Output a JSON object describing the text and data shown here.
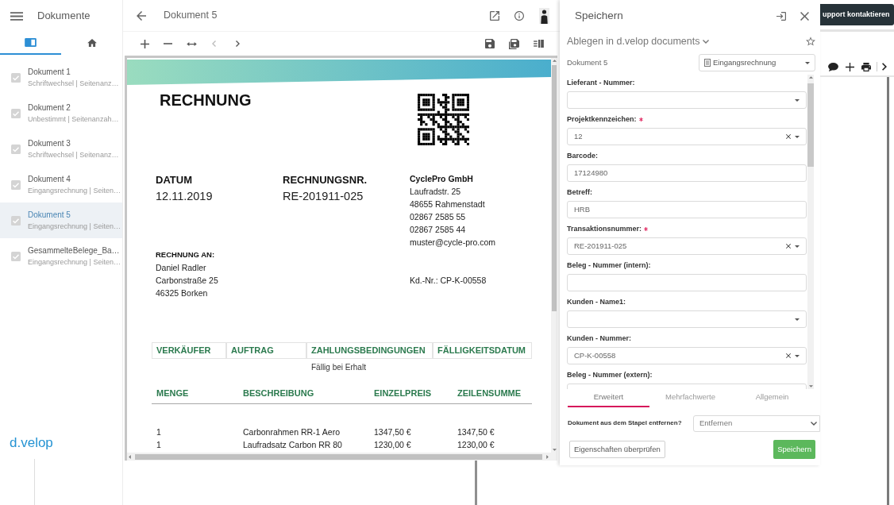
{
  "sidebar": {
    "title": "Dokumente",
    "tabs": [
      {
        "kind": "documents",
        "selected": true
      },
      {
        "kind": "home",
        "selected": false
      }
    ],
    "items": [
      {
        "title": "Dokument 1",
        "subtitle": "Schriftwechsel | Seitenanz…",
        "checked": true,
        "selected": false
      },
      {
        "title": "Dokument 2",
        "subtitle": "Unbestimmt | Seitenanzah…",
        "checked": true,
        "selected": false
      },
      {
        "title": "Dokument 3",
        "subtitle": "Schriftwechsel | Seitenanz…",
        "checked": true,
        "selected": false
      },
      {
        "title": "Dokument 4",
        "subtitle": "Eingangsrechnung | Seiten…",
        "checked": true,
        "selected": false
      },
      {
        "title": "Dokument 5",
        "subtitle": "Eingangsrechnung | Seiten…",
        "checked": true,
        "selected": true
      },
      {
        "title": "GesammelteBelege_Ba…",
        "subtitle": "Eingangsrechnung | Seiten…",
        "checked": true,
        "selected": false
      }
    ],
    "logo": "d.velop"
  },
  "document_header": {
    "title": "Dokument 5"
  },
  "viewer_toolbar": {
    "previous_disabled": true,
    "next_disabled": false
  },
  "document": {
    "heading": "RECHNUNG",
    "date_label": "DATUM",
    "date": "12.11.2019",
    "number_label": "RECHNUNGSNR.",
    "number": "RE-201911-025",
    "company_name": "CyclePro GmbH",
    "company_lines": [
      "Laufradstr. 25",
      "48655 Rahmenstadt",
      "02867 2585 55",
      "02867 2585 44",
      "muster@cycle-pro.com"
    ],
    "bill_to_label": "RECHNUNG AN:",
    "bill_to": [
      "Daniel Radler",
      "Carbonstraße 25",
      "46325 Borken"
    ],
    "customer_number": "Kd.-Nr.: CP-K-00558",
    "terms_table": {
      "columns": [
        "VERKÄUFER",
        "AUFTRAG",
        "ZAHLUNGSBEDINGUNGEN",
        "FÄLLIGKEITSDATUM"
      ],
      "rows": [
        [
          null,
          null,
          "Fällig bei Erhalt",
          null
        ]
      ]
    },
    "items_table": {
      "columns": [
        "MENGE",
        "BESCHREIBUNG",
        "EINZELPREIS",
        "ZEILENSUMME"
      ],
      "rows": [
        [
          "1",
          "Carbonrahmen RR-1 Aero",
          "1347,50 €",
          "1347,50 €"
        ],
        [
          "1",
          "Laufradsatz Carbon RR 80",
          "1230,00 €",
          "1230,00 €"
        ]
      ]
    }
  },
  "save_panel": {
    "title": "Speichern",
    "destination": "Ablegen in d.velop documents",
    "document_name": "Dokument 5",
    "document_type": "Eingangsrechnung",
    "fields": [
      {
        "label": "Lieferant - Nummer:",
        "required": false,
        "kind": "select"
      },
      {
        "label": "Projektkennzeichen:",
        "required": true,
        "kind": "select",
        "value": "12"
      },
      {
        "label": "Barcode:",
        "required": false,
        "kind": "input",
        "value": "17124980"
      },
      {
        "label": "Betreff:",
        "required": false,
        "kind": "input",
        "value": "HRB"
      },
      {
        "label": "Transaktionsnummer:",
        "required": true,
        "kind": "select",
        "value": "RE-201911-025"
      },
      {
        "label": "Beleg - Nummer (intern):",
        "required": false,
        "kind": "input"
      },
      {
        "label": "Kunden - Name1:",
        "required": false,
        "kind": "select"
      },
      {
        "label": "Kunden - Nummer:",
        "required": false,
        "kind": "select",
        "value": "CP-K-00558"
      },
      {
        "label": "Beleg - Nummer (extern):",
        "required": false,
        "kind": "input"
      }
    ],
    "tabs": [
      {
        "label": "Erweitert",
        "selected": true
      },
      {
        "label": "Mehrfachwerte",
        "selected": false
      },
      {
        "label": "Allgemein",
        "selected": false
      }
    ],
    "remove_question": "Dokument aus dem Stapel entfernen?",
    "remove_option": "Entfernen",
    "buttons": [
      {
        "label": "Eigenschaften überprüfen",
        "kind": "secondary"
      },
      {
        "label": "Speichern",
        "kind": "primary"
      }
    ]
  },
  "background_app": {
    "support_button": "upport kontaktieren"
  }
}
